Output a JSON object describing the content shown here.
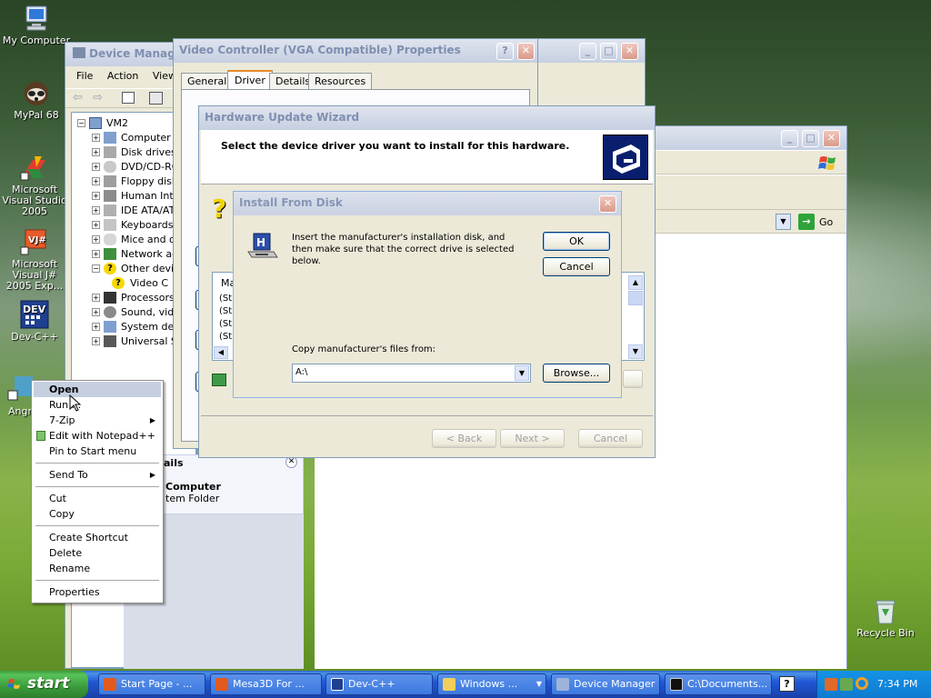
{
  "desktop": {
    "icons": [
      {
        "label": "My Computer"
      },
      {
        "label": "MyPal 68"
      },
      {
        "label": "Microsoft Visual Studio 2005"
      },
      {
        "label": "Microsoft Visual J# 2005 Exp..."
      },
      {
        "label": "Dev-C++"
      },
      {
        "label": "Angr"
      },
      {
        "label": "Recycle Bin"
      }
    ]
  },
  "device_manager": {
    "title": "Device Manager",
    "menu": [
      "File",
      "Action",
      "View"
    ],
    "root": "VM2",
    "items": [
      {
        "label": "Computer"
      },
      {
        "label": "Disk drives"
      },
      {
        "label": "DVD/CD-RO"
      },
      {
        "label": "Floppy disk"
      },
      {
        "label": "Human Inte"
      },
      {
        "label": "IDE ATA/AT"
      },
      {
        "label": "Keyboards"
      },
      {
        "label": "Mice and ot"
      },
      {
        "label": "Network ad"
      },
      {
        "label": "Other devic"
      },
      {
        "label": "Video C"
      },
      {
        "label": "Processors"
      },
      {
        "label": "Sound, vide"
      },
      {
        "label": "System dev"
      },
      {
        "label": "Universal S"
      }
    ]
  },
  "explorer": {
    "go_label": "Go",
    "details_title": "ails",
    "details_name": "Computer",
    "details_type": "tem Folder"
  },
  "video_props": {
    "title": "Video Controller (VGA Compatible) Properties",
    "tabs": [
      "General",
      "Driver",
      "Details",
      "Resources"
    ],
    "active_tab": "Driver"
  },
  "wizard": {
    "title": "Hardware Update Wizard",
    "heading": "Select the device driver you want to install for this hardware.",
    "list_header": "Ma",
    "list_rows": [
      "(St",
      "(St",
      "(St",
      "(St"
    ],
    "back_label": "< Back",
    "next_label": "Next >",
    "cancel_label": "Cancel"
  },
  "install_disk": {
    "title": "Install From Disk",
    "message": "Insert the manufacturer's installation disk, and then make sure that the correct drive is selected below.",
    "ok_label": "OK",
    "cancel_label": "Cancel",
    "copy_label": "Copy manufacturer's files from:",
    "path_value": "A:\\",
    "browse_label": "Browse..."
  },
  "context_menu": {
    "items": {
      "open": "Open",
      "run": "Run ...",
      "zip": "7-Zip",
      "notepad": "Edit with Notepad++",
      "pin": "Pin to Start menu",
      "sendto": "Send To",
      "cut": "Cut",
      "copy": "Copy",
      "shortcut": "Create Shortcut",
      "delete": "Delete",
      "rename": "Rename",
      "properties": "Properties"
    }
  },
  "taskbar": {
    "start_label": "start",
    "tasks": [
      {
        "label": "Start Page - ..."
      },
      {
        "label": "Mesa3D For ..."
      },
      {
        "label": "Dev-C++"
      },
      {
        "label": "Windows ..."
      },
      {
        "label": "Device Manager"
      },
      {
        "label": "C:\\Documents..."
      }
    ],
    "clock": "7:34 PM"
  }
}
